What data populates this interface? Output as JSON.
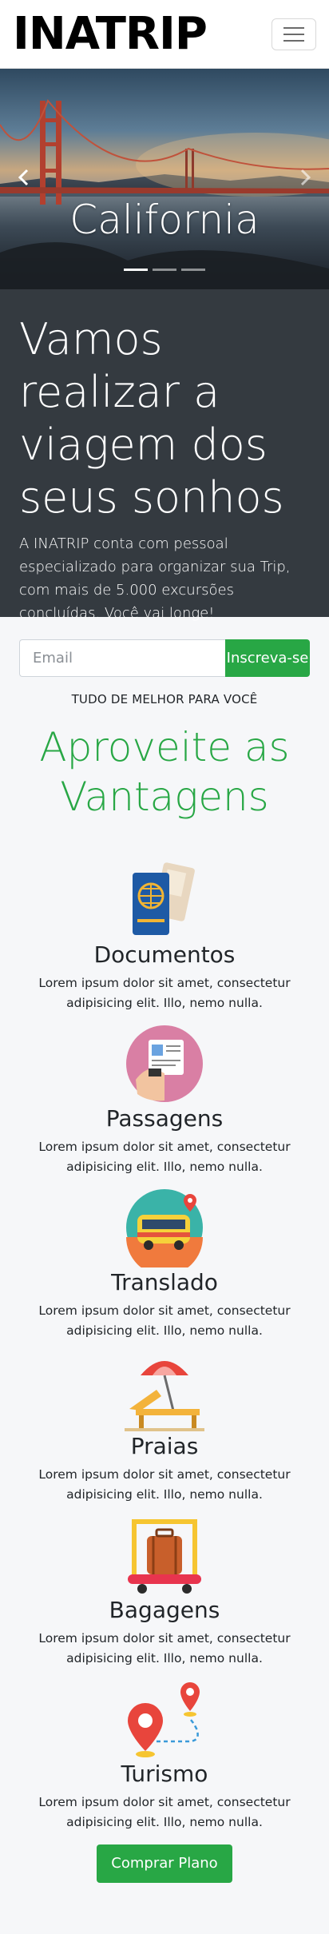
{
  "navbar": {
    "brand": "INATRIP",
    "menu_icon": "hamburger-icon"
  },
  "carousel": {
    "caption": "California",
    "slides": 3,
    "active_slide": 1,
    "prev_icon": "chevron-left-icon",
    "next_icon": "chevron-right-icon"
  },
  "hero": {
    "title": "Vamos realizar a viagem dos seus sonhos",
    "text": "A INATRIP conta com pessoal especializado para organizar sua Trip, com mais de 5.000 excursões concluídas. Você vai longe!",
    "email_placeholder": "Email",
    "subscribe_label": "Inscreva-se"
  },
  "features": {
    "eyebrow": "TUDO DE MELHOR PARA VOCÊ",
    "title": "Aproveite as Vantagens",
    "items": [
      {
        "title": "Documentos",
        "text": "Lorem ipsum dolor sit amet, consectetur adipisicing elit. Illo, nemo nulla.",
        "icon": "passport-icon"
      },
      {
        "title": "Passagens",
        "text": "Lorem ipsum dolor sit amet, consectetur adipisicing elit. Illo, nemo nulla.",
        "icon": "ticket-icon"
      },
      {
        "title": "Translado",
        "text": "Lorem ipsum dolor sit amet, consectetur adipisicing elit. Illo, nemo nulla.",
        "icon": "bus-icon"
      },
      {
        "title": "Praias",
        "text": "Lorem ipsum dolor sit amet, consectetur adipisicing elit. Illo, nemo nulla.",
        "icon": "beach-chair-icon"
      },
      {
        "title": "Bagagens",
        "text": "Lorem ipsum dolor sit amet, consectetur adipisicing elit. Illo, nemo nulla.",
        "icon": "luggage-cart-icon"
      },
      {
        "title": "Turismo",
        "text": "Lorem ipsum dolor sit amet, consectetur adipisicing elit. Illo, nemo nulla.",
        "icon": "map-pins-icon"
      }
    ],
    "cta_label": "Comprar Plano"
  },
  "colors": {
    "accent": "#28a745",
    "hero_bg": "#343a40",
    "page_bg": "#f6f7f9"
  }
}
